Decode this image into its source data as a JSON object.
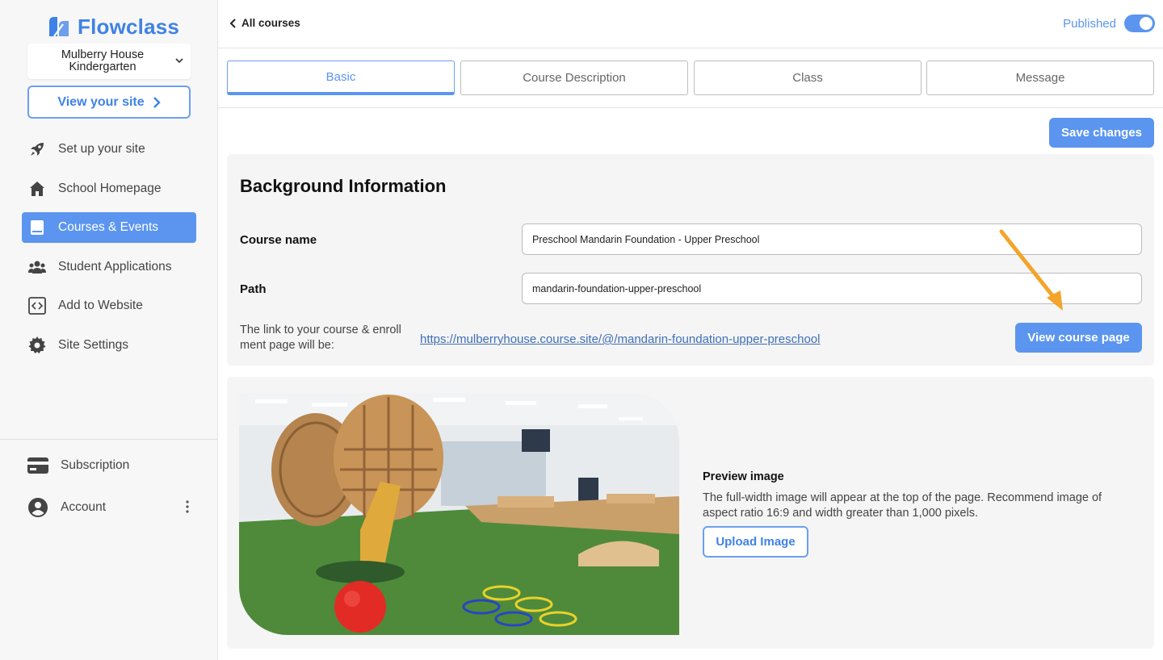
{
  "brand": {
    "name": "Flowclass",
    "accent": "#5b95ef"
  },
  "sidebar": {
    "site_name": "Mulberry House Kindergarten",
    "view_site_label": "View your site",
    "items": [
      {
        "label": "Set up your site",
        "icon": "rocket-icon"
      },
      {
        "label": "School Homepage",
        "icon": "home-icon"
      },
      {
        "label": "Courses & Events",
        "icon": "book-icon",
        "active": true
      },
      {
        "label": "Student Applications",
        "icon": "users-icon"
      },
      {
        "label": "Add to Website",
        "icon": "code-icon"
      },
      {
        "label": "Site Settings",
        "icon": "gear-icon"
      }
    ],
    "bottom": [
      {
        "label": "Subscription",
        "icon": "credit-card-icon"
      },
      {
        "label": "Account",
        "icon": "account-icon"
      }
    ]
  },
  "header": {
    "back_label": "All courses",
    "published_label": "Published",
    "published": true
  },
  "tabs": [
    {
      "label": "Basic",
      "active": true
    },
    {
      "label": "Course Description"
    },
    {
      "label": "Class"
    },
    {
      "label": "Message"
    }
  ],
  "actions": {
    "save_label": "Save changes"
  },
  "background_info": {
    "title": "Background Information",
    "course_name_label": "Course name",
    "course_name_value": "Preschool Mandarin Foundation - Upper Preschool",
    "path_label": "Path",
    "path_value": "mandarin-foundation-upper-preschool",
    "link_desc": "The link to your course & enroll ment page will be:",
    "link_url": "https://mulberryhouse.course.site/@/mandarin-foundation-upper-preschool",
    "view_course_label": "View course page"
  },
  "preview": {
    "title": "Preview image",
    "description": "The full-width image will appear at the top of the page. Recommend image of aspect ratio 16:9 and width greater than 1,000 pixels.",
    "upload_label": "Upload Image"
  }
}
